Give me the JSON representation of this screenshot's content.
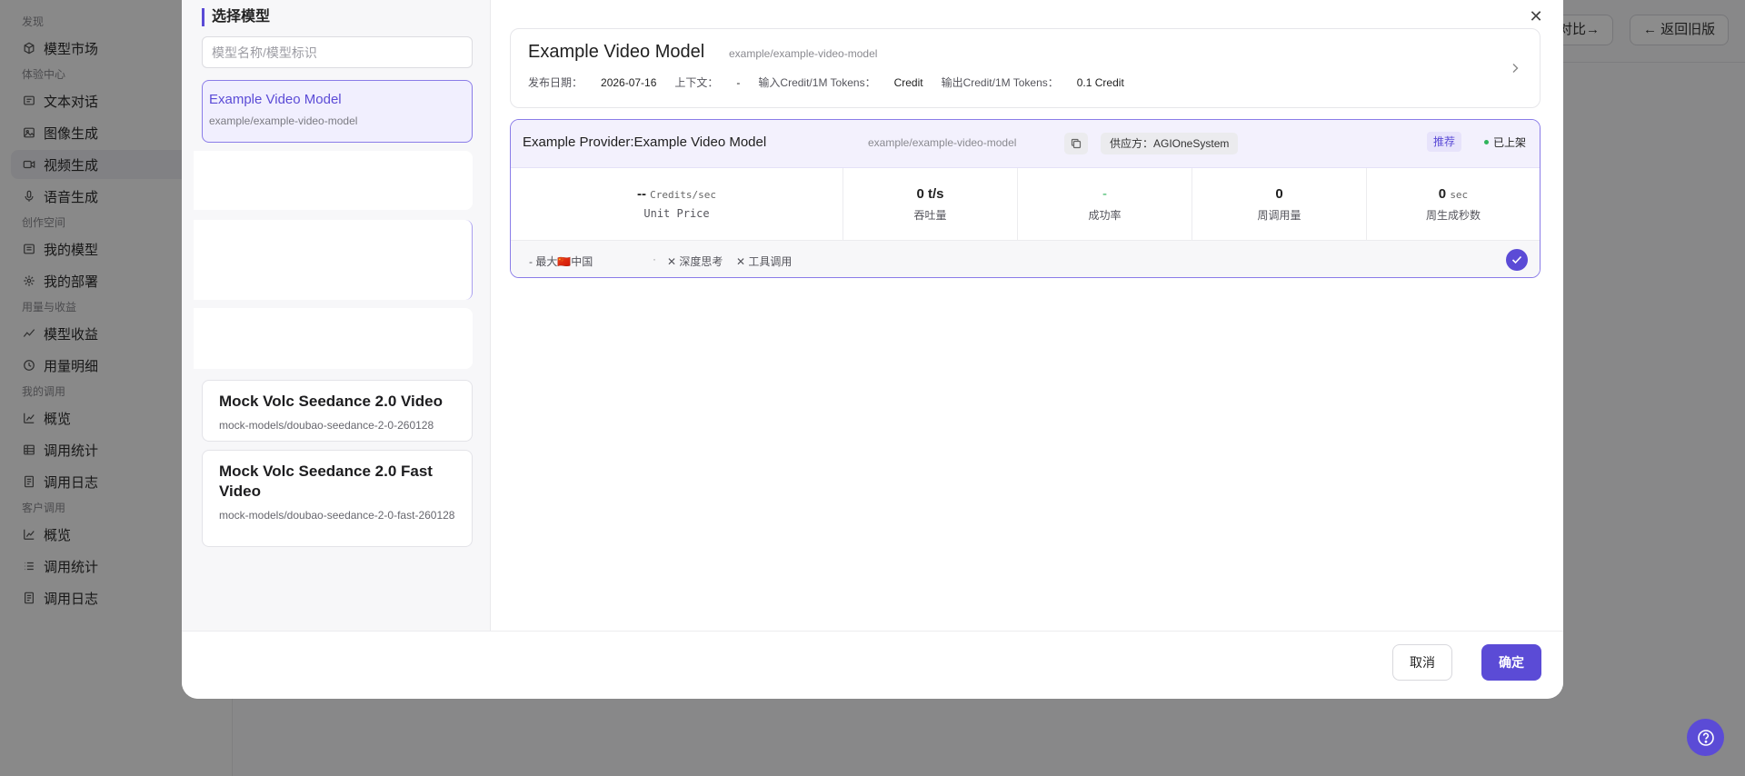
{
  "sidebar": {
    "groups": [
      {
        "label": "发现",
        "items": [
          {
            "label": "模型市场",
            "icon": "cube-icon"
          }
        ]
      },
      {
        "label": "体验中心",
        "items": [
          {
            "label": "文本对话",
            "icon": "chat-icon"
          },
          {
            "label": "图像生成",
            "icon": "image-icon"
          },
          {
            "label": "视频生成",
            "icon": "video-icon",
            "active": true
          },
          {
            "label": "语音生成",
            "icon": "mic-icon"
          }
        ]
      },
      {
        "label": "创作空间",
        "items": [
          {
            "label": "我的模型",
            "icon": "model-icon"
          },
          {
            "label": "我的部署",
            "icon": "deploy-icon"
          }
        ]
      },
      {
        "label": "用量与收益",
        "items": [
          {
            "label": "模型收益",
            "icon": "chart-line-icon"
          },
          {
            "label": "用量明细",
            "icon": "clock-icon"
          }
        ]
      },
      {
        "label": "我的调用",
        "items": [
          {
            "label": "概览",
            "icon": "bar-chart-icon"
          },
          {
            "label": "调用统计",
            "icon": "table-icon"
          },
          {
            "label": "调用日志",
            "icon": "log-icon"
          }
        ]
      },
      {
        "label": "客户调用",
        "items": [
          {
            "label": "概览",
            "icon": "bar-chart-icon"
          },
          {
            "label": "调用统计",
            "icon": "list-icon"
          },
          {
            "label": "调用日志",
            "icon": "log-icon"
          }
        ]
      }
    ]
  },
  "topbar": {
    "compare_label": "对比→",
    "back_label": "← 返回旧版"
  },
  "modal": {
    "title": "选择模型",
    "search_placeholder": "模型名称/模型标识",
    "models": [
      {
        "name": "Example Video Model",
        "slug": "example/example-video-model"
      },
      {
        "name": "Mock Volc Seedance 2.0 Video",
        "slug": "mock-models/doubao-seedance-2-0-260128"
      },
      {
        "name": "Mock Volc Seedance 2.0 Fast Video",
        "slug": "mock-models/doubao-seedance-2-0-fast-260128"
      }
    ],
    "detail": {
      "title": "Example Video Model",
      "slug": "example/example-video-model",
      "release_label": "发布日期：",
      "release_value": "2026-07-16",
      "context_label": "上下文：",
      "context_value": "-",
      "input_label": "输入Credit/1M Tokens：",
      "input_value": "Credit",
      "output_label": "输出Credit/1M Tokens：",
      "output_value": "0.1 Credit"
    },
    "provider": {
      "name": "Example Provider:Example Video Model",
      "slug": "example/example-video-model",
      "supplier": "供应方：AGIOneSystem",
      "recommend": "推荐",
      "status": "已上架",
      "stats": [
        {
          "value": "--",
          "unit": "Credits/sec",
          "label": "Unit Price"
        },
        {
          "value": "0 t/s",
          "unit": "",
          "label": "吞吐量"
        },
        {
          "value": "-",
          "unit": "",
          "label": "成功率"
        },
        {
          "value": "0",
          "unit": "",
          "label": "周调用量"
        },
        {
          "value": "0",
          "unit": "sec",
          "label": "周生成秒数"
        }
      ],
      "features": {
        "region": "- 最大🇨🇳中国",
        "separator": "·",
        "deep_think": "深度思考",
        "tool_call": "工具调用"
      }
    },
    "cancel_label": "取消",
    "confirm_label": "确定"
  },
  "colors": {
    "accent": "#5b4bd6",
    "success": "#30b45c"
  }
}
